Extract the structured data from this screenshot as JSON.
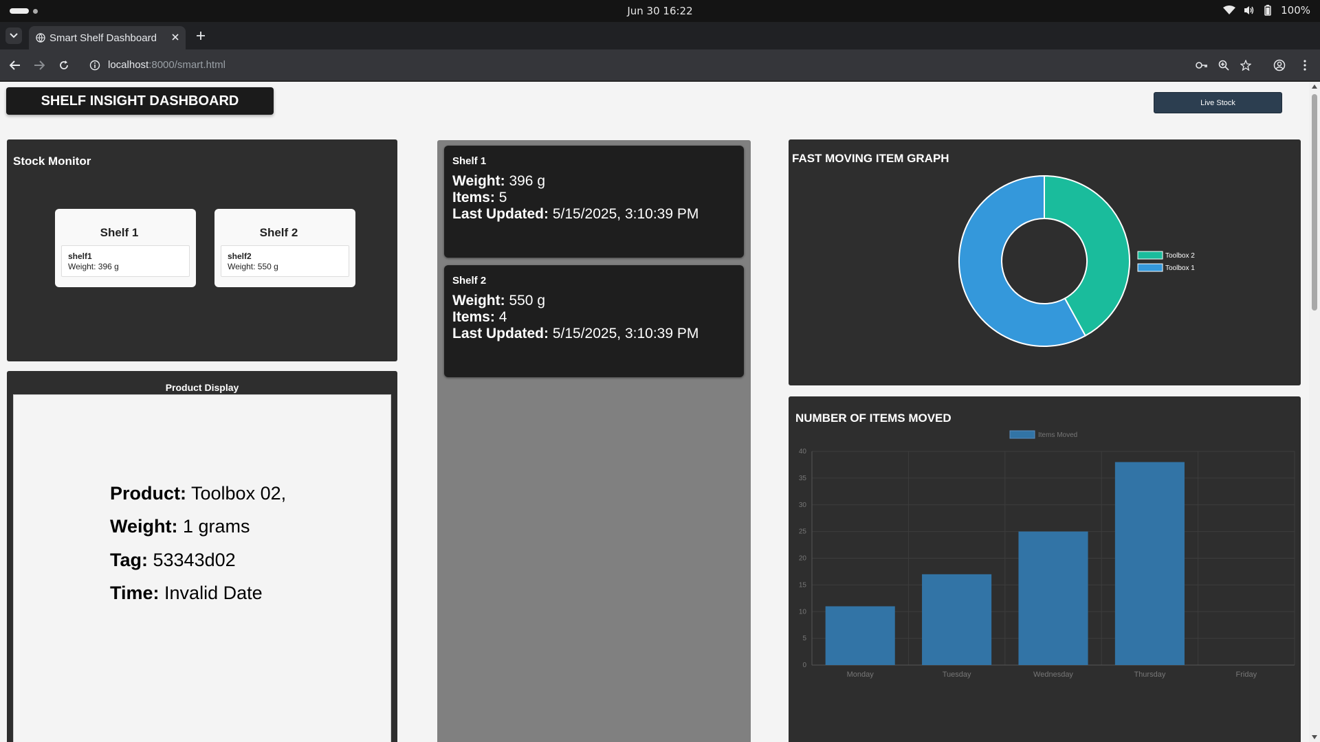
{
  "os": {
    "clock": "Jun 30  16:22",
    "battery": "100%"
  },
  "browser": {
    "tab_title": "Smart Shelf Dashboard",
    "url_host": "localhost",
    "url_path": ":8000/smart.html"
  },
  "header": {
    "title": "SHELF INSIGHT DASHBOARD",
    "live_button": "Live Stock"
  },
  "stock_monitor": {
    "title": "Stock Monitor",
    "shelves": [
      {
        "title": "Shelf 1",
        "id": "shelf1",
        "weight": "Weight: 396 g"
      },
      {
        "title": "Shelf 2",
        "id": "shelf2",
        "weight": "Weight: 550 g"
      }
    ]
  },
  "product_display": {
    "title": "Product Display",
    "product_label": "Product:",
    "product_value": " Toolbox 02,",
    "weight_label": "Weight:",
    "weight_value": " 1 grams",
    "tag_label": "Tag:",
    "tag_value": " 53343d02",
    "time_label": "Time:",
    "time_value": " Invalid Date"
  },
  "shelf_details": [
    {
      "title": "Shelf 1",
      "weight_label": "Weight:",
      "weight_value": " 396 g",
      "items_label": "Items:",
      "items_value": " 5",
      "updated_label": "Last Updated:",
      "updated_value": " 5/15/2025, 3:10:39 PM"
    },
    {
      "title": "Shelf 2",
      "weight_label": "Weight:",
      "weight_value": " 550 g",
      "items_label": "Items:",
      "items_value": " 4",
      "updated_label": "Last Updated:",
      "updated_value": " 5/15/2025, 3:10:39 PM"
    }
  ],
  "chart_data": [
    {
      "type": "pie",
      "title": "FAST MOVING ITEM GRAPH",
      "labels": [
        "Toolbox 2",
        "Toolbox 1"
      ],
      "values": [
        42,
        58
      ],
      "colors": [
        "#1abc9c",
        "#3498db"
      ],
      "legend": "right"
    },
    {
      "type": "bar",
      "title": "NUMBER OF ITEMS MOVED",
      "categories": [
        "Monday",
        "Tuesday",
        "Wednesday",
        "Thursday",
        "Friday"
      ],
      "series": [
        {
          "name": "Items Moved",
          "values": [
            11,
            17,
            25,
            38,
            0
          ]
        }
      ],
      "ylim": [
        0,
        40
      ],
      "yticks": [
        0,
        5,
        10,
        15,
        20,
        25,
        30,
        35,
        40
      ],
      "color": "#3274a6",
      "grid": true,
      "legend": "top"
    }
  ]
}
